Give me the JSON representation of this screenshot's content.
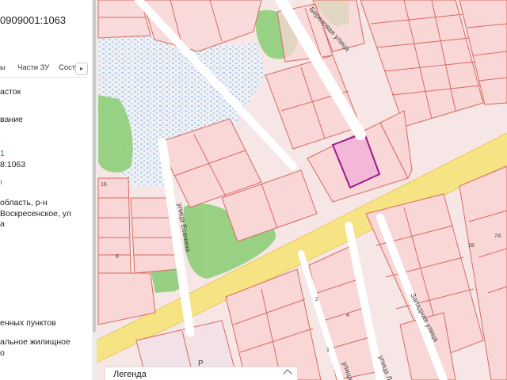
{
  "panel": {
    "title": "0909001:1063",
    "tabs": [
      "ы",
      "Части ЗУ",
      "Соста"
    ],
    "tab_scroll_icon": "chevron-right-icon",
    "lines": [
      "асток",
      "вание",
      "8:1063",
      "область, р-н",
      "Воскресенское, ул",
      "а",
      "енных пунктов",
      "альное жилищное",
      "о"
    ],
    "hint": "1"
  },
  "map": {
    "street_labels": [
      "Березовая улица",
      "улица Есенина",
      "Западная улица",
      "улица Ле",
      "улица"
    ],
    "house_numbers": [
      "16",
      "8",
      "2",
      "4",
      "7А",
      "18",
      "1"
    ],
    "parking_symbol": "P",
    "colors": {
      "parcel_fill": "#f9d7d7",
      "parcel_stroke": "#d9695f",
      "road": "#f6e383",
      "green": "#8fcf7b",
      "water_hatch": "#7fa8d6",
      "selected_fill": "#f3b7d8",
      "selected_stroke": "#9a1a8e"
    }
  },
  "legend": {
    "label": "Легенда",
    "icon": "chevron-up-icon"
  }
}
